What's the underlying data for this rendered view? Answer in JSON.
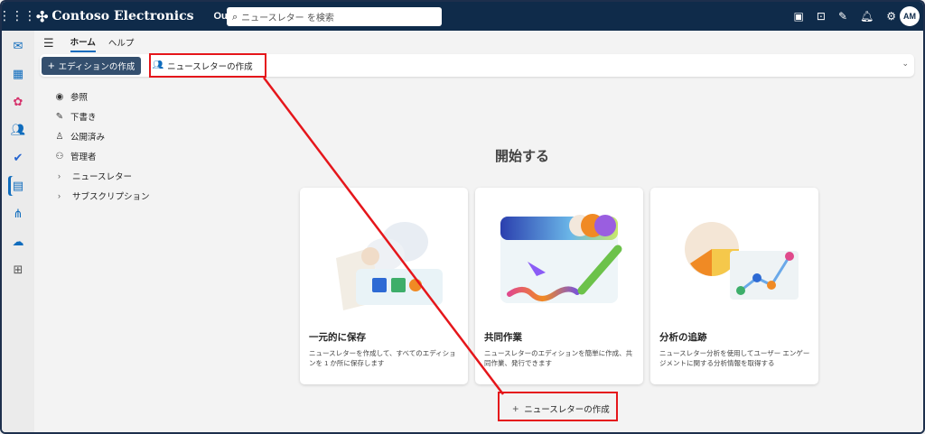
{
  "brand": {
    "name": "Contoso Electronics"
  },
  "app": {
    "name": "Outlook"
  },
  "search": {
    "placeholder": "ニュースレター を検索"
  },
  "user": {
    "initials": "AM"
  },
  "tabs": [
    {
      "label": "ホーム"
    },
    {
      "label": "ヘルプ"
    }
  ],
  "ribbon": {
    "create_edition": "エディションの作成",
    "create_newsletter": "ニュースレターの作成"
  },
  "nav": [
    {
      "label": "参照"
    },
    {
      "label": "下書き"
    },
    {
      "label": "公開済み"
    },
    {
      "label": "管理者"
    },
    {
      "label": "ニュースレター"
    },
    {
      "label": "サブスクリプション"
    }
  ],
  "main": {
    "heading": "開始する",
    "cards": [
      {
        "title": "一元的に保存",
        "desc": "ニュースレターを作成して、すべてのエディションを 1 か所に保存します"
      },
      {
        "title": "共同作業",
        "desc": "ニュースレターのエディションを簡単に作成、共同作業、発行できます"
      },
      {
        "title": "分析の追跡",
        "desc": "ニュースレター分析を使用してユーザー エンゲージメントに関する分析情報を取得する"
      }
    ],
    "create_button": "ニュースレターの作成"
  },
  "colors": {
    "topbar": "#0f2b4a",
    "accent": "#0f6cbd",
    "annotation": "#e5161b"
  }
}
